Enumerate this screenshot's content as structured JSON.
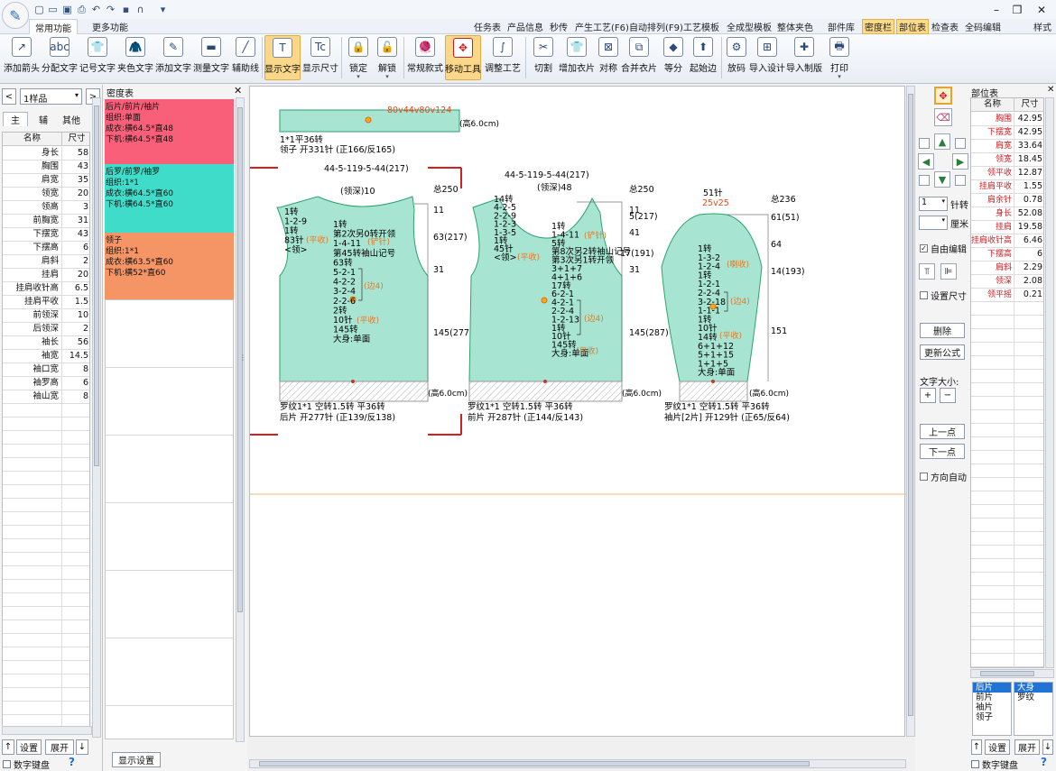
{
  "titlebar": {
    "qa_icons": [
      "new-file-icon",
      "open-folder-icon",
      "save-icon",
      "print-icon",
      "undo-icon",
      "redo-icon",
      "save-disk-icon",
      "magnet-icon",
      "dropdown-icon"
    ],
    "window_controls": [
      "–",
      "❐",
      "✕"
    ]
  },
  "tabs": [
    "常用功能",
    "更多功能"
  ],
  "top_links": [
    "任务表",
    "产品信息",
    "秒传",
    "产生工艺(F6)",
    "自动排列(F9)",
    "工艺模板",
    "全成型模板",
    "整体夹色",
    "部件库",
    "密度栏",
    "部位表",
    "检查表",
    "全码编辑",
    "样式"
  ],
  "ribbon": [
    {
      "label": "添加箭头",
      "glyph": "↗"
    },
    {
      "label": "分配文字",
      "glyph": "abc"
    },
    {
      "label": "记号文字",
      "glyph": "👕"
    },
    {
      "label": "夹色文字",
      "glyph": "🧥"
    },
    {
      "label": "添加文字",
      "glyph": "✎"
    },
    {
      "label": "测量文字",
      "glyph": "▬"
    },
    {
      "label": "辅助线",
      "glyph": "╱"
    },
    {
      "label": "显示文字",
      "glyph": "T"
    },
    {
      "label": "显示尺寸",
      "glyph": "Tc"
    },
    {
      "label": "锁定",
      "glyph": "🔒"
    },
    {
      "label": "解锁",
      "glyph": "🔓"
    },
    {
      "label": "常规款式",
      "glyph": "🧶"
    },
    {
      "label": "移动工具",
      "glyph": "✥"
    },
    {
      "label": "调整工艺",
      "glyph": "∫"
    },
    {
      "label": "切割",
      "glyph": "✂"
    },
    {
      "label": "增加衣片",
      "glyph": "👕"
    },
    {
      "label": "对称",
      "glyph": "⊠"
    },
    {
      "label": "合并衣片",
      "glyph": "⧉"
    },
    {
      "label": "等分",
      "glyph": "◆"
    },
    {
      "label": "起始边",
      "glyph": "⬆"
    },
    {
      "label": "放码",
      "glyph": "⚙"
    },
    {
      "label": "导入设计",
      "glyph": "⊞"
    },
    {
      "label": "导入制版",
      "glyph": "✚"
    },
    {
      "label": "打印",
      "glyph": "🖶"
    }
  ],
  "left": {
    "sample": "1样品",
    "tabs": [
      "主",
      "辅",
      "其他"
    ],
    "header": [
      "名称",
      "尺寸"
    ],
    "rows": [
      [
        "身长",
        "58"
      ],
      [
        "胸围",
        "43"
      ],
      [
        "肩宽",
        "35"
      ],
      [
        "领宽",
        "20"
      ],
      [
        "领高",
        "3"
      ],
      [
        "前胸宽",
        "31"
      ],
      [
        "下摆宽",
        "43"
      ],
      [
        "下摆高",
        "6"
      ],
      [
        "肩斜",
        "2"
      ],
      [
        "挂肩",
        "20"
      ],
      [
        "挂肩收针高",
        "6.5"
      ],
      [
        "挂肩平收",
        "1.5"
      ],
      [
        "前领深",
        "10"
      ],
      [
        "后领深",
        "2"
      ],
      [
        "袖长",
        "56"
      ],
      [
        "袖宽",
        "14.5"
      ],
      [
        "袖口宽",
        "8"
      ],
      [
        "袖罗高",
        "6"
      ],
      [
        "袖山宽",
        "8"
      ]
    ],
    "buttons": [
      "↑",
      "设置",
      "展开",
      "↓"
    ],
    "numpad": "数字键盘",
    "help": "?"
  },
  "density": {
    "title": "密度表",
    "cards": [
      {
        "color": "#fa5f79",
        "lines": [
          "后片/前片/袖片",
          "组织:单面",
          "成衣:横64.5*直48",
          "下机:横64.5*直48"
        ]
      },
      {
        "color": "#3fdcc9",
        "lines": [
          "后罗/前罗/袖罗",
          "组织:1*1",
          "成衣:横64.5*直60",
          "下机:横64.5*直60"
        ]
      },
      {
        "color": "#f59464",
        "lines": [
          "领子",
          "组织:1*1",
          "成衣:横63.5*直60",
          "下机:横52*直60"
        ]
      }
    ],
    "show_settings": "显示设置"
  },
  "canvas": {
    "collar": {
      "top": "80v44v80v124",
      "side": "(高6.0cm)",
      "l1": "1*1平36转",
      "l2": "领子 开331针 (正166/反165)"
    },
    "back": {
      "top": "44-5-119-5-44(217)",
      "neck": "(领深)10",
      "total": "总250",
      "r1": "11",
      "r2": "63(217)",
      "r3": "31",
      "r4": "145(277)",
      "side": "(高6.0cm)",
      "left_lines": [
        "1转",
        "1-2-9",
        "1转",
        "83针",
        "<领>"
      ],
      "flat": "(平收)",
      "mid_lines": [
        "1转",
        "第2次另0转开领",
        "1-4-11",
        "第45转袖山记号",
        "63转",
        "5-2-1",
        "4-2-2",
        "3-2-4",
        "2-2-6",
        "2转",
        "10针",
        "145转",
        "大身:单面"
      ],
      "orange_a": "(铲针)",
      "orange_b": "(边4)",
      "orange_c": "(平收)",
      "b1": "罗纹1*1 空转1.5转 平36转",
      "b2": "后片 开277针 (正139/反138)"
    },
    "front": {
      "top": "44-5-119-5-44(217)",
      "neck": "(领深)48",
      "total": "总250",
      "r1": "11",
      "r1b": "5(217)",
      "r2": "41",
      "r3": "17(191)",
      "r4": "31",
      "r5": "145(287)",
      "side": "(高6.0cm)",
      "left_lines": [
        "14转",
        "4-2-5",
        "2-2-9",
        "1-2-3",
        "1-3-5",
        "1转",
        "45针",
        "<领>"
      ],
      "flat": "(平收)",
      "mid_lines": [
        "1转",
        "1-4-11",
        "5转",
        "第8次另2转袖山记号",
        "第3次另1转开领",
        "3+1+7",
        "4+1+6",
        "17转",
        "6-2-1",
        "4-2-1",
        "2-2-4",
        "1-2-13",
        "1转",
        "10针",
        "145转",
        "大身:单面"
      ],
      "orange_a": "(铲针)",
      "orange_b": "(边4)",
      "orange_c": "(平收)",
      "b1": "罗纹1*1 空转1.5转 平36转",
      "b2": "前片 开287针 (正144/反143)"
    },
    "sleeve": {
      "top": "51针",
      "top_red": "25v25",
      "total": "总236",
      "r1": "61(51)",
      "r2": "64",
      "r3": "14(193)",
      "r4": "151",
      "side": "(高6.0cm)",
      "mid_lines": [
        "1转",
        "1-3-2",
        "1-2-4",
        "1转",
        "1-2-1",
        "2-2-4",
        "3-2-18",
        "1-1-1",
        "1转",
        "10针",
        "14转",
        "6+1+12",
        "5+1+15",
        "1+1+5",
        "大身:单面"
      ],
      "orange_a": "(喇收)",
      "orange_b": "(边4)",
      "orange_c": "(平收)",
      "b1": "罗纹1*1 空转1.5转 平36转",
      "b2": "袖片[2片] 开129针 (正65/反64)"
    }
  },
  "controls": {
    "needle_val": "1",
    "needle_label": "针转",
    "cm_label": "厘米",
    "free_edit": "自由编辑",
    "set_size": "设置尺寸",
    "delete": "删除",
    "update": "更新公式",
    "font_size": "文字大小:",
    "plus": "+",
    "minus": "−",
    "prev": "上一点",
    "next": "下一点",
    "direction": "方向自动"
  },
  "right": {
    "title": "部位表",
    "header": [
      "名称",
      "尺寸"
    ],
    "rows": [
      [
        "胸围",
        "42.95"
      ],
      [
        "下摆宽",
        "42.95"
      ],
      [
        "肩宽",
        "33.64"
      ],
      [
        "领宽",
        "18.45"
      ],
      [
        "领平收",
        "12.87"
      ],
      [
        "挂肩平收",
        "1.55"
      ],
      [
        "肩余针",
        "0.78"
      ],
      [
        "身长",
        "52.08"
      ],
      [
        "挂肩",
        "19.58"
      ],
      [
        "挂肩收针高",
        "6.46"
      ],
      [
        "下摆高",
        "6"
      ],
      [
        "肩斜",
        "2.29"
      ],
      [
        "领深",
        "2.08"
      ],
      [
        "领平摇",
        "0.21"
      ]
    ],
    "pieces": [
      "后片",
      "前片",
      "袖片",
      "领子"
    ],
    "parts": [
      "大身",
      "罗纹"
    ],
    "buttons": [
      "↑",
      "设置",
      "展开",
      "↓"
    ],
    "numpad": "数字键盘",
    "help": "?"
  }
}
